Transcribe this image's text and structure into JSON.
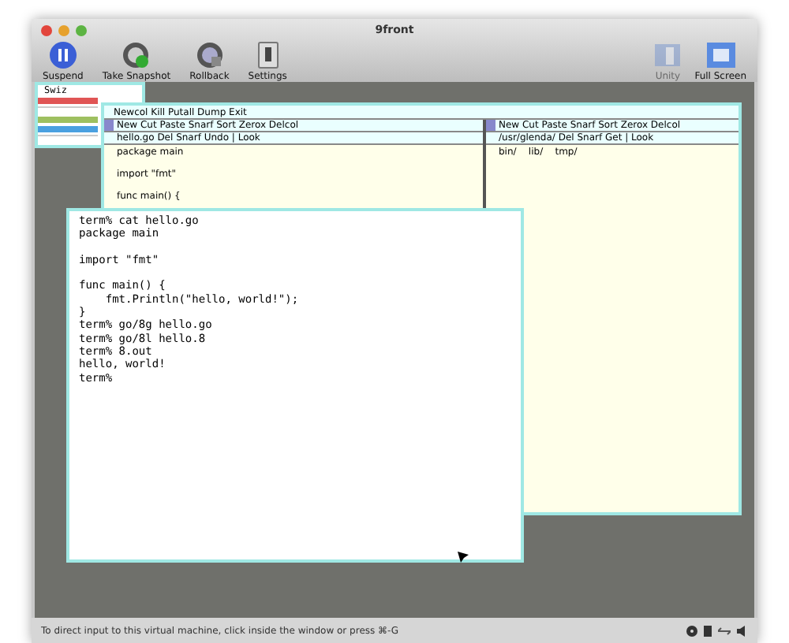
{
  "window": {
    "title": "9front"
  },
  "toolbar": {
    "left": [
      {
        "label": "Suspend",
        "kind": "pause",
        "disabled": false
      },
      {
        "label": "Take Snapshot",
        "kind": "snapshot",
        "disabled": false
      },
      {
        "label": "Rollback",
        "kind": "rollback",
        "disabled": false
      },
      {
        "label": "Settings",
        "kind": "settings",
        "disabled": false
      }
    ],
    "right": [
      {
        "label": "Unity",
        "kind": "unity",
        "disabled": true
      },
      {
        "label": "Full Screen",
        "kind": "fullscreen",
        "disabled": false
      }
    ]
  },
  "stats_window": {
    "title": "Swiz"
  },
  "acme": {
    "tag": "Newcol Kill Putall Dump Exit",
    "columns": [
      {
        "tag": "New Cut Paste Snarf Sort Zerox Delcol",
        "window_tag": "hello.go Del Snarf Undo | Look",
        "body": [
          [
            "package main"
          ],
          [
            "import \"fmt\""
          ],
          [
            "func main() {"
          ]
        ]
      },
      {
        "tag": "New Cut Paste Snarf Sort Zerox Delcol",
        "window_tag": "/usr/glenda/ Del Snarf Get | Look",
        "body": [
          [
            "bin/    lib/    tmp/"
          ]
        ]
      }
    ]
  },
  "terminal": {
    "blocks": [
      [
        "term% cat hello.go",
        "package main"
      ],
      [
        "import \"fmt\""
      ],
      [
        "func main() {",
        "    fmt.Println(\"hello, world!\");",
        "}",
        "term% go/8g hello.go",
        "term% go/8l hello.8",
        "term% 8.out",
        "hello, world!",
        "term% "
      ]
    ]
  },
  "status_bar": {
    "text": "To direct input to this virtual machine, click inside the window or press ⌘-G"
  }
}
